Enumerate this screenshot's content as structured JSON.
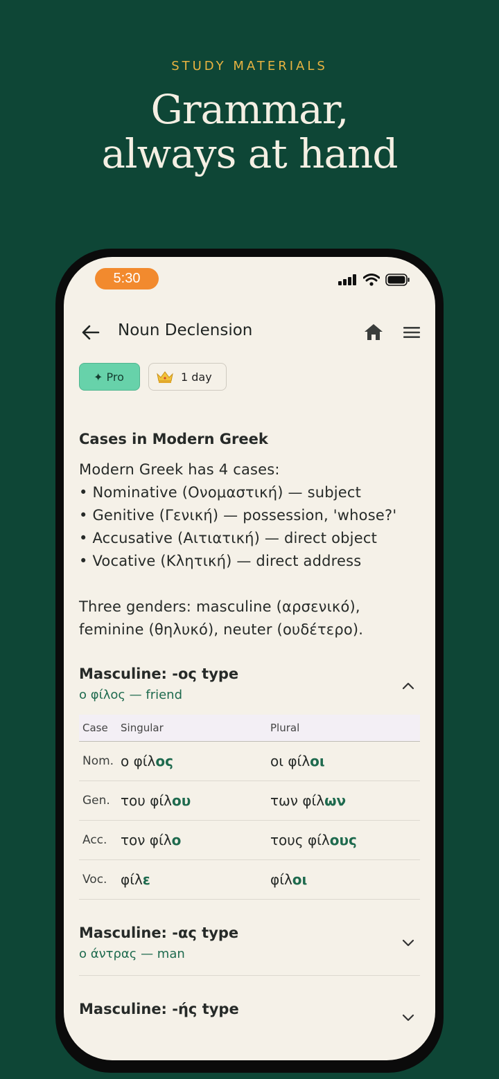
{
  "promo": {
    "eyebrow": "STUDY MATERIALS",
    "headline_line1": "Grammar,",
    "headline_line2": "always at hand"
  },
  "status_bar": {
    "time": "5:30"
  },
  "appbar": {
    "title": "Noun Declension",
    "back_icon": "arrow-left-icon",
    "home_icon": "home-icon",
    "menu_icon": "hamburger-menu-icon"
  },
  "badges": {
    "pro": "✦ Pro",
    "day_icon": "crown-icon",
    "day": "1 day"
  },
  "section": {
    "title": "Cases in Modern Greek",
    "intro": "Modern Greek has 4 cases:",
    "cases": [
      "• Nominative (Ονομαστική) — subject",
      "• Genitive (Γενική) — possession, 'whose?'",
      "• Accusative (Αιτιατική) — direct object",
      "• Vocative (Κλητική) — direct address"
    ],
    "genders_line1": "Three genders: masculine (αρσενικό),",
    "genders_line2": "feminine (θηλυκό), neuter (ουδέτερο)."
  },
  "groups": [
    {
      "title": "Masculine: -ος type",
      "subtitle": "ο φίλος — friend",
      "expanded": true,
      "headers": [
        "Case",
        "Singular",
        "Plural"
      ],
      "rows": [
        {
          "case": "Nom.",
          "sg_stem": "ο φίλ",
          "sg_end": "ος",
          "pl_stem": "οι φίλ",
          "pl_end": "οι"
        },
        {
          "case": "Gen.",
          "sg_stem": "του φίλ",
          "sg_end": "ου",
          "pl_stem": "των φίλ",
          "pl_end": "ων"
        },
        {
          "case": "Acc.",
          "sg_stem": "τον φίλ",
          "sg_end": "ο",
          "pl_stem": "τους φίλ",
          "pl_end": "ους"
        },
        {
          "case": "Voc.",
          "sg_stem": "φίλ",
          "sg_end": "ε",
          "pl_stem": "φίλ",
          "pl_end": "οι"
        }
      ]
    },
    {
      "title": "Masculine: -ας type",
      "subtitle": "ο άντρας — man",
      "expanded": false
    },
    {
      "title": "Masculine: -ής type",
      "expanded": false
    }
  ],
  "colors": {
    "background": "#0e4636",
    "accent": "#e8b341",
    "green_text": "#1e6a4e",
    "pro_badge": "#67d2aa",
    "time_pill": "#f28a2e"
  }
}
